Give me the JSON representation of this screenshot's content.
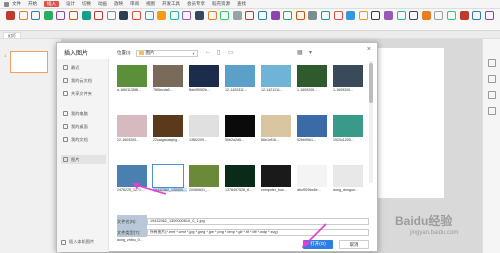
{
  "menubar": {
    "items": [
      "文件",
      "开始",
      "插入",
      "设计",
      "切换",
      "动画",
      "放映",
      "审阅",
      "视图",
      "开发工具",
      "会员专享",
      "稻壳资源",
      "查找"
    ],
    "active_index": 2
  },
  "document_tab": "幻灯",
  "slide_number": "1",
  "dialog": {
    "title": "插入图片",
    "close": "×",
    "location_label": "位置(I):",
    "location_value": "图片",
    "sidebar": [
      {
        "label": "最近"
      },
      {
        "label": "我的云文档"
      },
      {
        "label": "共享文件夹"
      },
      {
        "label": "我的电脑"
      },
      {
        "label": "我的桌面"
      },
      {
        "label": "我的文档"
      },
      {
        "label": "图片"
      }
    ],
    "selected_sidebar": 6,
    "sidebar_bottom": "插入本机图片",
    "files": [
      {
        "name": "d-1f601135f8...",
        "color": "#5b8f3a"
      },
      {
        "name": "7f85ecda0...",
        "color": "#7a6a5a"
      },
      {
        "name": "8de0f00f2b...",
        "color": "#1b2d4a"
      },
      {
        "name": "12-1420311...",
        "color": "#5aa0c8"
      },
      {
        "name": "12-1421211...",
        "color": "#6fb3d6"
      },
      {
        "name": "1-1609200...",
        "color": "#2f5a2c"
      },
      {
        "name": "1-1609200...",
        "color": "#3a4a5a"
      },
      {
        "name": "22-1609200...",
        "color": "#d7b9c0"
      },
      {
        "name": "22caigaoaiqing...",
        "color": "#5a3a1a"
      },
      {
        "name": "13f62209...",
        "color": "#e0e0e0"
      },
      {
        "name": "50b2a2d5...",
        "color": "#0a0a0a"
      },
      {
        "name": "66e1ef16...",
        "color": "#d9c6a0"
      },
      {
        "name": "52bb99b1...",
        "color": "#3a6aa8"
      },
      {
        "name": "1920x1200...",
        "color": "#3a9a8a"
      },
      {
        "name": "2476225_1271...",
        "color": "#4a80b0"
      },
      {
        "name": "19432362_130000...",
        "color": "#ffffff"
      },
      {
        "name": "20080601_...",
        "color": "#6a8a3a"
      },
      {
        "name": "1378497528_8...",
        "color": "#0a2a1a"
      },
      {
        "name": "computer_bus...",
        "color": "#1a1a1a"
      },
      {
        "name": "dbcf929bc6e...",
        "color": "#f4f4f4"
      },
      {
        "name": "dong_donguo...",
        "color": "#e8e8e8"
      },
      {
        "name": "dong_zhibu_0...",
        "color": "#b8c8d8"
      }
    ],
    "selected_file": 15,
    "filename_label": "文件名(N):",
    "filename_value": "19432362_1300000810_0_1.jpg",
    "filetype_label": "文件类型(T):",
    "filetype_value": "所有图片(*.emf *.wmf *.jpg *.jpeg *.jpe *.png *.bmp *.gif *.tif *.tiff *.wdp *.svg)",
    "open_label": "打开(O)",
    "cancel_label": "取消"
  },
  "watermark": {
    "text": "Baidu经验",
    "sub": "jingyan.baidu.com"
  }
}
